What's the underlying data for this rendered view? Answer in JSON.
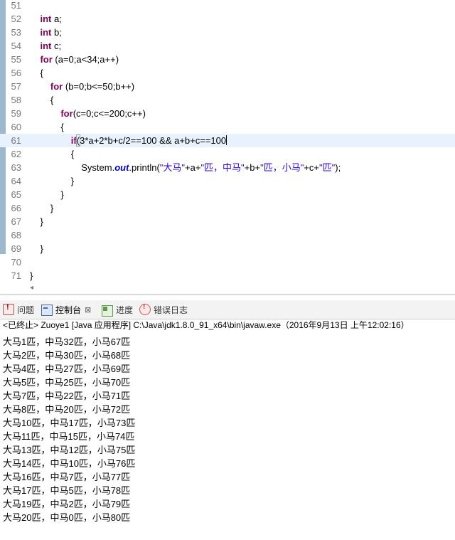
{
  "editor": {
    "lines": [
      {
        "num": "51",
        "html": ""
      },
      {
        "num": "52",
        "html": "    <span class=\"kw\">int</span> a;"
      },
      {
        "num": "53",
        "html": "    <span class=\"kw\">int</span> b;"
      },
      {
        "num": "54",
        "html": "    <span class=\"kw\">int</span> c;"
      },
      {
        "num": "55",
        "html": "    <span class=\"kw\">for</span> (a=0;a&lt;34;a++)"
      },
      {
        "num": "56",
        "html": "    {"
      },
      {
        "num": "57",
        "html": "        <span class=\"kw\">for</span> (b=0;b&lt;=50;b++)"
      },
      {
        "num": "58",
        "html": "        {"
      },
      {
        "num": "59",
        "html": "            <span class=\"kw\">for</span>(c=0;c&lt;=200;c++)"
      },
      {
        "num": "60",
        "html": "            {"
      },
      {
        "num": "61",
        "html": "                <span class=\"kw\">if</span><span class=\"bracket-box\">(</span>3*a+2*b+c/2==100 &amp;&amp; a+b+c==100<span class=\"caret\"></span>"
      },
      {
        "num": "62",
        "html": "                {"
      },
      {
        "num": "63",
        "html": "                    System.<span class=\"field\">out</span>.println(<span class=\"str\">\"大马\"</span>+a+<span class=\"str\">\"匹，中马\"</span>+b+<span class=\"str\">\"匹，小马\"</span>+c+<span class=\"str\">\"匹\"</span>);"
      },
      {
        "num": "64",
        "html": "                }"
      },
      {
        "num": "65",
        "html": "            }"
      },
      {
        "num": "66",
        "html": "        }"
      },
      {
        "num": "67",
        "html": "    }"
      },
      {
        "num": "68",
        "html": ""
      },
      {
        "num": "69",
        "html": "    }"
      },
      {
        "num": "70",
        "html": ""
      },
      {
        "num": "71",
        "html": "}"
      }
    ],
    "current_line": "61"
  },
  "panel": {
    "tabs": [
      {
        "label": "问题",
        "icon": "problems-icon"
      },
      {
        "label": "控制台",
        "icon": "console-icon",
        "close": "⊠"
      },
      {
        "label": "进度",
        "icon": "progress-icon"
      },
      {
        "label": "错误日志",
        "icon": "error-log-icon"
      }
    ],
    "console_header": "<已终止> Zuoye1 [Java 应用程序] C:\\Java\\jdk1.8.0_91_x64\\bin\\javaw.exe（2016年9月13日 上午12:02:16）",
    "output": [
      "大马1匹，中马32匹，小马67匹",
      "大马2匹，中马30匹，小马68匹",
      "大马4匹，中马27匹，小马69匹",
      "大马5匹，中马25匹，小马70匹",
      "大马7匹，中马22匹，小马71匹",
      "大马8匹，中马20匹，小马72匹",
      "大马10匹，中马17匹，小马73匹",
      "大马11匹，中马15匹，小马74匹",
      "大马13匹，中马12匹，小马75匹",
      "大马14匹，中马10匹，小马76匹",
      "大马16匹，中马7匹，小马77匹",
      "大马17匹，中马5匹，小马78匹",
      "大马19匹，中马2匹，小马79匹",
      "大马20匹，中马0匹，小马80匹"
    ]
  },
  "colors": {
    "keyword": "#7f0055",
    "string": "#2a00ff",
    "static_field": "#0000c0",
    "current_line": "#e8f2fe",
    "change_bar": "#9db7cf"
  }
}
